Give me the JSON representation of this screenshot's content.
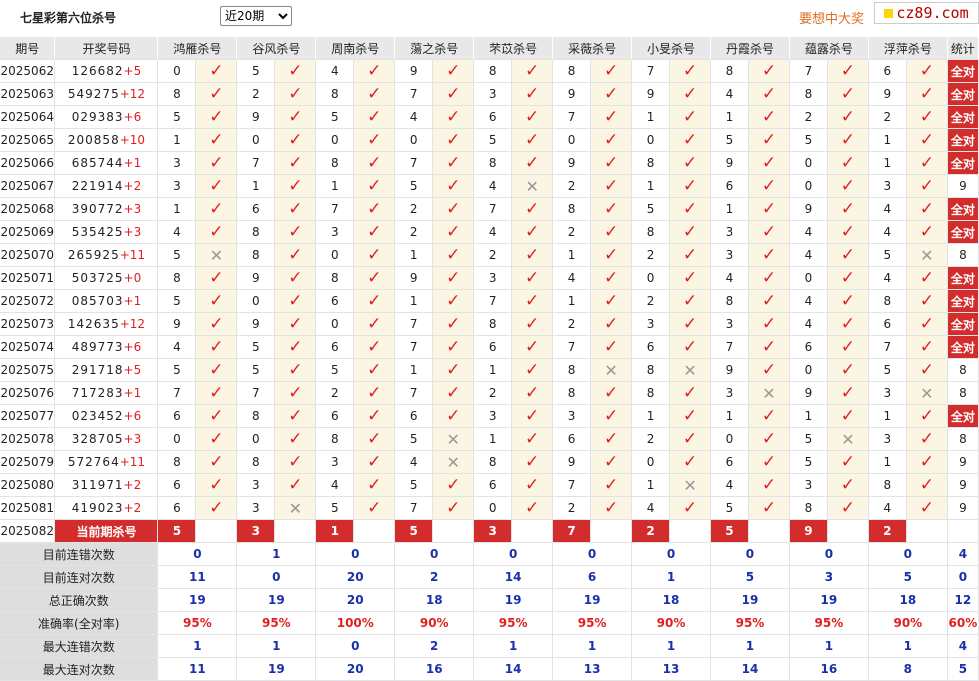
{
  "header": {
    "title": "七星彩第六位杀号",
    "period_select": "近20期",
    "slogan": "要想中大奖",
    "logo": "cz89.com"
  },
  "columns": {
    "period": "期号",
    "draw": "开奖号码",
    "experts": [
      "鸿雁杀号",
      "谷风杀号",
      "周南杀号",
      "蕩之杀号",
      "芣苡杀号",
      "采薇杀号",
      "小旻杀号",
      "丹霞杀号",
      "蕴露杀号",
      "浮萍杀号"
    ],
    "stat": "统计"
  },
  "rows": [
    {
      "period": "2025062",
      "digits": "126682",
      "plus": "+5",
      "kills": [
        "0",
        "5",
        "4",
        "9",
        "8",
        "8",
        "7",
        "8",
        "7",
        "6"
      ],
      "ok": [
        1,
        1,
        1,
        1,
        1,
        1,
        1,
        1,
        1,
        1
      ],
      "stat": "全对"
    },
    {
      "period": "2025063",
      "digits": "549275",
      "plus": "+12",
      "kills": [
        "8",
        "2",
        "8",
        "7",
        "3",
        "9",
        "9",
        "4",
        "8",
        "9"
      ],
      "ok": [
        1,
        1,
        1,
        1,
        1,
        1,
        1,
        1,
        1,
        1
      ],
      "stat": "全对"
    },
    {
      "period": "2025064",
      "digits": "029383",
      "plus": "+6",
      "kills": [
        "5",
        "9",
        "5",
        "4",
        "6",
        "7",
        "1",
        "1",
        "2",
        "2"
      ],
      "ok": [
        1,
        1,
        1,
        1,
        1,
        1,
        1,
        1,
        1,
        1
      ],
      "stat": "全对"
    },
    {
      "period": "2025065",
      "digits": "200858",
      "plus": "+10",
      "kills": [
        "1",
        "0",
        "0",
        "0",
        "5",
        "0",
        "0",
        "5",
        "5",
        "1"
      ],
      "ok": [
        1,
        1,
        1,
        1,
        1,
        1,
        1,
        1,
        1,
        1
      ],
      "stat": "全对"
    },
    {
      "period": "2025066",
      "digits": "685744",
      "plus": "+1",
      "kills": [
        "3",
        "7",
        "8",
        "7",
        "8",
        "9",
        "8",
        "9",
        "0",
        "1"
      ],
      "ok": [
        1,
        1,
        1,
        1,
        1,
        1,
        1,
        1,
        1,
        1
      ],
      "stat": "全对"
    },
    {
      "period": "2025067",
      "digits": "221914",
      "plus": "+2",
      "kills": [
        "3",
        "1",
        "1",
        "5",
        "4",
        "2",
        "1",
        "6",
        "0",
        "3"
      ],
      "ok": [
        1,
        1,
        1,
        1,
        0,
        1,
        1,
        1,
        1,
        1
      ],
      "stat": "9"
    },
    {
      "period": "2025068",
      "digits": "390772",
      "plus": "+3",
      "kills": [
        "1",
        "6",
        "7",
        "2",
        "7",
        "8",
        "5",
        "1",
        "9",
        "4"
      ],
      "ok": [
        1,
        1,
        1,
        1,
        1,
        1,
        1,
        1,
        1,
        1
      ],
      "stat": "全对"
    },
    {
      "period": "2025069",
      "digits": "535425",
      "plus": "+3",
      "kills": [
        "4",
        "8",
        "3",
        "2",
        "4",
        "2",
        "8",
        "3",
        "4",
        "4"
      ],
      "ok": [
        1,
        1,
        1,
        1,
        1,
        1,
        1,
        1,
        1,
        1
      ],
      "stat": "全对"
    },
    {
      "period": "2025070",
      "digits": "265925",
      "plus": "+11",
      "kills": [
        "5",
        "8",
        "0",
        "1",
        "2",
        "1",
        "2",
        "3",
        "4",
        "5"
      ],
      "ok": [
        0,
        1,
        1,
        1,
        1,
        1,
        1,
        1,
        1,
        0
      ],
      "stat": "8"
    },
    {
      "period": "2025071",
      "digits": "503725",
      "plus": "+0",
      "kills": [
        "8",
        "9",
        "8",
        "9",
        "3",
        "4",
        "0",
        "4",
        "0",
        "4"
      ],
      "ok": [
        1,
        1,
        1,
        1,
        1,
        1,
        1,
        1,
        1,
        1
      ],
      "stat": "全对"
    },
    {
      "period": "2025072",
      "digits": "085703",
      "plus": "+1",
      "kills": [
        "5",
        "0",
        "6",
        "1",
        "7",
        "1",
        "2",
        "8",
        "4",
        "8"
      ],
      "ok": [
        1,
        1,
        1,
        1,
        1,
        1,
        1,
        1,
        1,
        1
      ],
      "stat": "全对"
    },
    {
      "period": "2025073",
      "digits": "142635",
      "plus": "+12",
      "kills": [
        "9",
        "9",
        "0",
        "7",
        "8",
        "2",
        "3",
        "3",
        "4",
        "6"
      ],
      "ok": [
        1,
        1,
        1,
        1,
        1,
        1,
        1,
        1,
        1,
        1
      ],
      "stat": "全对"
    },
    {
      "period": "2025074",
      "digits": "489773",
      "plus": "+6",
      "kills": [
        "4",
        "5",
        "6",
        "7",
        "6",
        "7",
        "6",
        "7",
        "6",
        "7"
      ],
      "ok": [
        1,
        1,
        1,
        1,
        1,
        1,
        1,
        1,
        1,
        1
      ],
      "stat": "全对"
    },
    {
      "period": "2025075",
      "digits": "291718",
      "plus": "+5",
      "kills": [
        "5",
        "5",
        "5",
        "1",
        "1",
        "8",
        "8",
        "9",
        "0",
        "5"
      ],
      "ok": [
        1,
        1,
        1,
        1,
        1,
        0,
        0,
        1,
        1,
        1
      ],
      "stat": "8"
    },
    {
      "period": "2025076",
      "digits": "717283",
      "plus": "+1",
      "kills": [
        "7",
        "7",
        "2",
        "7",
        "2",
        "8",
        "8",
        "3",
        "9",
        "3"
      ],
      "ok": [
        1,
        1,
        1,
        1,
        1,
        1,
        1,
        0,
        1,
        0
      ],
      "stat": "8"
    },
    {
      "period": "2025077",
      "digits": "023452",
      "plus": "+6",
      "kills": [
        "6",
        "8",
        "6",
        "6",
        "3",
        "3",
        "1",
        "1",
        "1",
        "1"
      ],
      "ok": [
        1,
        1,
        1,
        1,
        1,
        1,
        1,
        1,
        1,
        1
      ],
      "stat": "全对"
    },
    {
      "period": "2025078",
      "digits": "328705",
      "plus": "+3",
      "kills": [
        "0",
        "0",
        "8",
        "5",
        "1",
        "6",
        "2",
        "0",
        "5",
        "3"
      ],
      "ok": [
        1,
        1,
        1,
        0,
        1,
        1,
        1,
        1,
        0,
        1
      ],
      "stat": "8"
    },
    {
      "period": "2025079",
      "digits": "572764",
      "plus": "+11",
      "kills": [
        "8",
        "8",
        "3",
        "4",
        "8",
        "9",
        "0",
        "6",
        "5",
        "1"
      ],
      "ok": [
        1,
        1,
        1,
        0,
        1,
        1,
        1,
        1,
        1,
        1
      ],
      "stat": "9"
    },
    {
      "period": "2025080",
      "digits": "311971",
      "plus": "+2",
      "kills": [
        "6",
        "3",
        "4",
        "5",
        "6",
        "7",
        "1",
        "4",
        "3",
        "8"
      ],
      "ok": [
        1,
        1,
        1,
        1,
        1,
        1,
        0,
        1,
        1,
        1
      ],
      "stat": "9"
    },
    {
      "period": "2025081",
      "digits": "419023",
      "plus": "+2",
      "kills": [
        "6",
        "3",
        "5",
        "7",
        "0",
        "2",
        "4",
        "5",
        "8",
        "4"
      ],
      "ok": [
        1,
        0,
        1,
        1,
        1,
        1,
        1,
        1,
        1,
        1
      ],
      "stat": "9"
    }
  ],
  "current": {
    "period": "2025082",
    "label": "当前期杀号",
    "kills": [
      "5",
      "3",
      "1",
      "5",
      "3",
      "7",
      "2",
      "5",
      "9",
      "2"
    ]
  },
  "footer": [
    {
      "label": "目前连错次数",
      "values": [
        "0",
        "1",
        "0",
        "0",
        "0",
        "0",
        "0",
        "0",
        "0",
        "0"
      ],
      "stat": "4",
      "type": "num"
    },
    {
      "label": "目前连对次数",
      "values": [
        "11",
        "0",
        "20",
        "2",
        "14",
        "6",
        "1",
        "5",
        "3",
        "5"
      ],
      "stat": "0",
      "type": "num"
    },
    {
      "label": "总正确次数",
      "values": [
        "19",
        "19",
        "20",
        "18",
        "19",
        "19",
        "18",
        "19",
        "19",
        "18"
      ],
      "stat": "12",
      "type": "num"
    },
    {
      "label": "准确率(全对率)",
      "values": [
        "95%",
        "95%",
        "100%",
        "90%",
        "95%",
        "95%",
        "90%",
        "95%",
        "95%",
        "90%"
      ],
      "stat": "60%",
      "type": "pct"
    },
    {
      "label": "最大连错次数",
      "values": [
        "1",
        "1",
        "0",
        "2",
        "1",
        "1",
        "1",
        "1",
        "1",
        "1"
      ],
      "stat": "4",
      "type": "num"
    },
    {
      "label": "最大连对次数",
      "values": [
        "11",
        "19",
        "20",
        "16",
        "14",
        "13",
        "13",
        "14",
        "16",
        "8"
      ],
      "stat": "5",
      "type": "num"
    }
  ],
  "colors": {
    "accent_red": "#d22c2c",
    "check_red": "#e02020",
    "footer_blue": "#1a2faa",
    "slogan_orange": "#e0701e"
  },
  "icons": {
    "ok": "check-icon",
    "fail": "cross-icon"
  }
}
